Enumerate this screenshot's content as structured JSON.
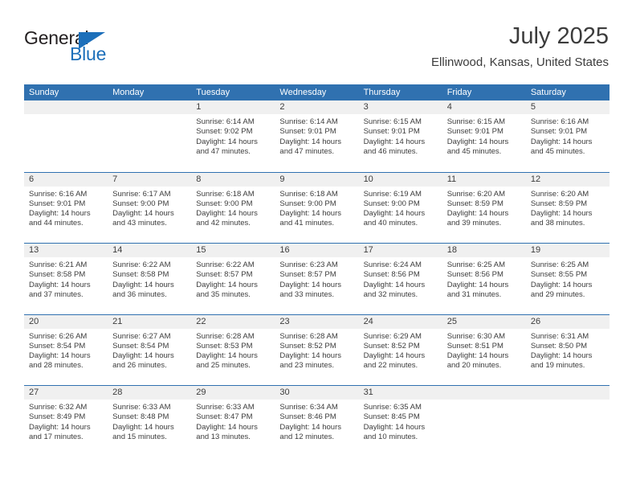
{
  "brand": {
    "word_one": "General",
    "word_two": "Blue",
    "mark": "triangle-logo"
  },
  "header": {
    "title": "July 2025",
    "location": "Ellinwood, Kansas, United States"
  },
  "colors": {
    "header_blue": "#3071b0",
    "brand_blue": "#1c6fba",
    "day_band_gray": "#f0f0f0",
    "text": "#3c3c3c"
  },
  "calendar": {
    "day_headers": [
      "Sunday",
      "Monday",
      "Tuesday",
      "Wednesday",
      "Thursday",
      "Friday",
      "Saturday"
    ],
    "weeks": [
      [
        {
          "day": "",
          "lines": []
        },
        {
          "day": "",
          "lines": []
        },
        {
          "day": "1",
          "lines": [
            "Sunrise: 6:14 AM",
            "Sunset: 9:02 PM",
            "Daylight: 14 hours",
            "and 47 minutes."
          ]
        },
        {
          "day": "2",
          "lines": [
            "Sunrise: 6:14 AM",
            "Sunset: 9:01 PM",
            "Daylight: 14 hours",
            "and 47 minutes."
          ]
        },
        {
          "day": "3",
          "lines": [
            "Sunrise: 6:15 AM",
            "Sunset: 9:01 PM",
            "Daylight: 14 hours",
            "and 46 minutes."
          ]
        },
        {
          "day": "4",
          "lines": [
            "Sunrise: 6:15 AM",
            "Sunset: 9:01 PM",
            "Daylight: 14 hours",
            "and 45 minutes."
          ]
        },
        {
          "day": "5",
          "lines": [
            "Sunrise: 6:16 AM",
            "Sunset: 9:01 PM",
            "Daylight: 14 hours",
            "and 45 minutes."
          ]
        }
      ],
      [
        {
          "day": "6",
          "lines": [
            "Sunrise: 6:16 AM",
            "Sunset: 9:01 PM",
            "Daylight: 14 hours",
            "and 44 minutes."
          ]
        },
        {
          "day": "7",
          "lines": [
            "Sunrise: 6:17 AM",
            "Sunset: 9:00 PM",
            "Daylight: 14 hours",
            "and 43 minutes."
          ]
        },
        {
          "day": "8",
          "lines": [
            "Sunrise: 6:18 AM",
            "Sunset: 9:00 PM",
            "Daylight: 14 hours",
            "and 42 minutes."
          ]
        },
        {
          "day": "9",
          "lines": [
            "Sunrise: 6:18 AM",
            "Sunset: 9:00 PM",
            "Daylight: 14 hours",
            "and 41 minutes."
          ]
        },
        {
          "day": "10",
          "lines": [
            "Sunrise: 6:19 AM",
            "Sunset: 9:00 PM",
            "Daylight: 14 hours",
            "and 40 minutes."
          ]
        },
        {
          "day": "11",
          "lines": [
            "Sunrise: 6:20 AM",
            "Sunset: 8:59 PM",
            "Daylight: 14 hours",
            "and 39 minutes."
          ]
        },
        {
          "day": "12",
          "lines": [
            "Sunrise: 6:20 AM",
            "Sunset: 8:59 PM",
            "Daylight: 14 hours",
            "and 38 minutes."
          ]
        }
      ],
      [
        {
          "day": "13",
          "lines": [
            "Sunrise: 6:21 AM",
            "Sunset: 8:58 PM",
            "Daylight: 14 hours",
            "and 37 minutes."
          ]
        },
        {
          "day": "14",
          "lines": [
            "Sunrise: 6:22 AM",
            "Sunset: 8:58 PM",
            "Daylight: 14 hours",
            "and 36 minutes."
          ]
        },
        {
          "day": "15",
          "lines": [
            "Sunrise: 6:22 AM",
            "Sunset: 8:57 PM",
            "Daylight: 14 hours",
            "and 35 minutes."
          ]
        },
        {
          "day": "16",
          "lines": [
            "Sunrise: 6:23 AM",
            "Sunset: 8:57 PM",
            "Daylight: 14 hours",
            "and 33 minutes."
          ]
        },
        {
          "day": "17",
          "lines": [
            "Sunrise: 6:24 AM",
            "Sunset: 8:56 PM",
            "Daylight: 14 hours",
            "and 32 minutes."
          ]
        },
        {
          "day": "18",
          "lines": [
            "Sunrise: 6:25 AM",
            "Sunset: 8:56 PM",
            "Daylight: 14 hours",
            "and 31 minutes."
          ]
        },
        {
          "day": "19",
          "lines": [
            "Sunrise: 6:25 AM",
            "Sunset: 8:55 PM",
            "Daylight: 14 hours",
            "and 29 minutes."
          ]
        }
      ],
      [
        {
          "day": "20",
          "lines": [
            "Sunrise: 6:26 AM",
            "Sunset: 8:54 PM",
            "Daylight: 14 hours",
            "and 28 minutes."
          ]
        },
        {
          "day": "21",
          "lines": [
            "Sunrise: 6:27 AM",
            "Sunset: 8:54 PM",
            "Daylight: 14 hours",
            "and 26 minutes."
          ]
        },
        {
          "day": "22",
          "lines": [
            "Sunrise: 6:28 AM",
            "Sunset: 8:53 PM",
            "Daylight: 14 hours",
            "and 25 minutes."
          ]
        },
        {
          "day": "23",
          "lines": [
            "Sunrise: 6:28 AM",
            "Sunset: 8:52 PM",
            "Daylight: 14 hours",
            "and 23 minutes."
          ]
        },
        {
          "day": "24",
          "lines": [
            "Sunrise: 6:29 AM",
            "Sunset: 8:52 PM",
            "Daylight: 14 hours",
            "and 22 minutes."
          ]
        },
        {
          "day": "25",
          "lines": [
            "Sunrise: 6:30 AM",
            "Sunset: 8:51 PM",
            "Daylight: 14 hours",
            "and 20 minutes."
          ]
        },
        {
          "day": "26",
          "lines": [
            "Sunrise: 6:31 AM",
            "Sunset: 8:50 PM",
            "Daylight: 14 hours",
            "and 19 minutes."
          ]
        }
      ],
      [
        {
          "day": "27",
          "lines": [
            "Sunrise: 6:32 AM",
            "Sunset: 8:49 PM",
            "Daylight: 14 hours",
            "and 17 minutes."
          ]
        },
        {
          "day": "28",
          "lines": [
            "Sunrise: 6:33 AM",
            "Sunset: 8:48 PM",
            "Daylight: 14 hours",
            "and 15 minutes."
          ]
        },
        {
          "day": "29",
          "lines": [
            "Sunrise: 6:33 AM",
            "Sunset: 8:47 PM",
            "Daylight: 14 hours",
            "and 13 minutes."
          ]
        },
        {
          "day": "30",
          "lines": [
            "Sunrise: 6:34 AM",
            "Sunset: 8:46 PM",
            "Daylight: 14 hours",
            "and 12 minutes."
          ]
        },
        {
          "day": "31",
          "lines": [
            "Sunrise: 6:35 AM",
            "Sunset: 8:45 PM",
            "Daylight: 14 hours",
            "and 10 minutes."
          ]
        },
        {
          "day": "",
          "lines": []
        },
        {
          "day": "",
          "lines": []
        }
      ]
    ]
  }
}
